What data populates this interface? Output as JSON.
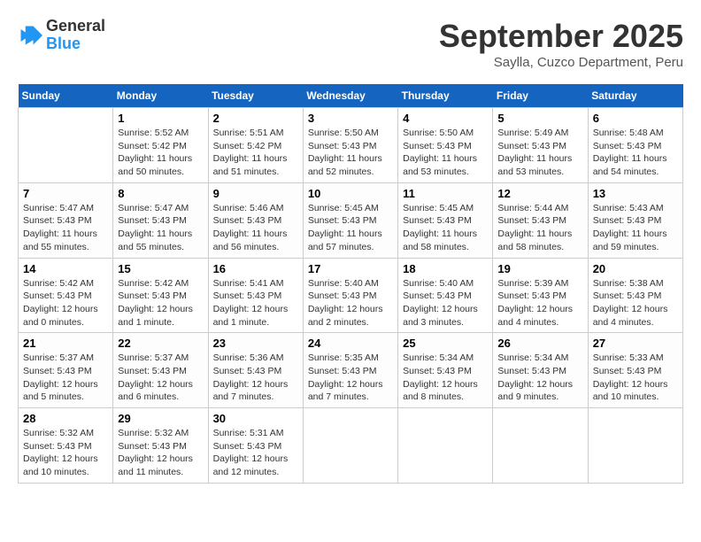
{
  "header": {
    "logo_line1": "General",
    "logo_line2": "Blue",
    "month": "September 2025",
    "location": "Saylla, Cuzco Department, Peru"
  },
  "days_of_week": [
    "Sunday",
    "Monday",
    "Tuesday",
    "Wednesday",
    "Thursday",
    "Friday",
    "Saturday"
  ],
  "weeks": [
    [
      {
        "day": "",
        "info": ""
      },
      {
        "day": "1",
        "info": "Sunrise: 5:52 AM\nSunset: 5:42 PM\nDaylight: 11 hours\nand 50 minutes."
      },
      {
        "day": "2",
        "info": "Sunrise: 5:51 AM\nSunset: 5:42 PM\nDaylight: 11 hours\nand 51 minutes."
      },
      {
        "day": "3",
        "info": "Sunrise: 5:50 AM\nSunset: 5:43 PM\nDaylight: 11 hours\nand 52 minutes."
      },
      {
        "day": "4",
        "info": "Sunrise: 5:50 AM\nSunset: 5:43 PM\nDaylight: 11 hours\nand 53 minutes."
      },
      {
        "day": "5",
        "info": "Sunrise: 5:49 AM\nSunset: 5:43 PM\nDaylight: 11 hours\nand 53 minutes."
      },
      {
        "day": "6",
        "info": "Sunrise: 5:48 AM\nSunset: 5:43 PM\nDaylight: 11 hours\nand 54 minutes."
      }
    ],
    [
      {
        "day": "7",
        "info": "Sunrise: 5:47 AM\nSunset: 5:43 PM\nDaylight: 11 hours\nand 55 minutes."
      },
      {
        "day": "8",
        "info": "Sunrise: 5:47 AM\nSunset: 5:43 PM\nDaylight: 11 hours\nand 55 minutes."
      },
      {
        "day": "9",
        "info": "Sunrise: 5:46 AM\nSunset: 5:43 PM\nDaylight: 11 hours\nand 56 minutes."
      },
      {
        "day": "10",
        "info": "Sunrise: 5:45 AM\nSunset: 5:43 PM\nDaylight: 11 hours\nand 57 minutes."
      },
      {
        "day": "11",
        "info": "Sunrise: 5:45 AM\nSunset: 5:43 PM\nDaylight: 11 hours\nand 58 minutes."
      },
      {
        "day": "12",
        "info": "Sunrise: 5:44 AM\nSunset: 5:43 PM\nDaylight: 11 hours\nand 58 minutes."
      },
      {
        "day": "13",
        "info": "Sunrise: 5:43 AM\nSunset: 5:43 PM\nDaylight: 11 hours\nand 59 minutes."
      }
    ],
    [
      {
        "day": "14",
        "info": "Sunrise: 5:42 AM\nSunset: 5:43 PM\nDaylight: 12 hours\nand 0 minutes."
      },
      {
        "day": "15",
        "info": "Sunrise: 5:42 AM\nSunset: 5:43 PM\nDaylight: 12 hours\nand 1 minute."
      },
      {
        "day": "16",
        "info": "Sunrise: 5:41 AM\nSunset: 5:43 PM\nDaylight: 12 hours\nand 1 minute."
      },
      {
        "day": "17",
        "info": "Sunrise: 5:40 AM\nSunset: 5:43 PM\nDaylight: 12 hours\nand 2 minutes."
      },
      {
        "day": "18",
        "info": "Sunrise: 5:40 AM\nSunset: 5:43 PM\nDaylight: 12 hours\nand 3 minutes."
      },
      {
        "day": "19",
        "info": "Sunrise: 5:39 AM\nSunset: 5:43 PM\nDaylight: 12 hours\nand 4 minutes."
      },
      {
        "day": "20",
        "info": "Sunrise: 5:38 AM\nSunset: 5:43 PM\nDaylight: 12 hours\nand 4 minutes."
      }
    ],
    [
      {
        "day": "21",
        "info": "Sunrise: 5:37 AM\nSunset: 5:43 PM\nDaylight: 12 hours\nand 5 minutes."
      },
      {
        "day": "22",
        "info": "Sunrise: 5:37 AM\nSunset: 5:43 PM\nDaylight: 12 hours\nand 6 minutes."
      },
      {
        "day": "23",
        "info": "Sunrise: 5:36 AM\nSunset: 5:43 PM\nDaylight: 12 hours\nand 7 minutes."
      },
      {
        "day": "24",
        "info": "Sunrise: 5:35 AM\nSunset: 5:43 PM\nDaylight: 12 hours\nand 7 minutes."
      },
      {
        "day": "25",
        "info": "Sunrise: 5:34 AM\nSunset: 5:43 PM\nDaylight: 12 hours\nand 8 minutes."
      },
      {
        "day": "26",
        "info": "Sunrise: 5:34 AM\nSunset: 5:43 PM\nDaylight: 12 hours\nand 9 minutes."
      },
      {
        "day": "27",
        "info": "Sunrise: 5:33 AM\nSunset: 5:43 PM\nDaylight: 12 hours\nand 10 minutes."
      }
    ],
    [
      {
        "day": "28",
        "info": "Sunrise: 5:32 AM\nSunset: 5:43 PM\nDaylight: 12 hours\nand 10 minutes."
      },
      {
        "day": "29",
        "info": "Sunrise: 5:32 AM\nSunset: 5:43 PM\nDaylight: 12 hours\nand 11 minutes."
      },
      {
        "day": "30",
        "info": "Sunrise: 5:31 AM\nSunset: 5:43 PM\nDaylight: 12 hours\nand 12 minutes."
      },
      {
        "day": "",
        "info": ""
      },
      {
        "day": "",
        "info": ""
      },
      {
        "day": "",
        "info": ""
      },
      {
        "day": "",
        "info": ""
      }
    ]
  ]
}
